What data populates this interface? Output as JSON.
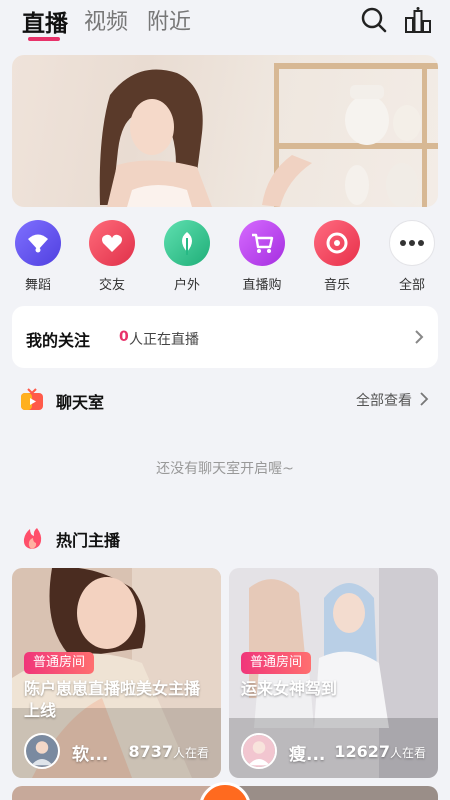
{
  "header": {
    "tabs": [
      {
        "label": "直播",
        "active": true
      },
      {
        "label": "视频",
        "active": false
      },
      {
        "label": "附近",
        "active": false
      }
    ],
    "icons": [
      "search-icon",
      "ranking-icon"
    ],
    "accent": "#e8326a"
  },
  "banner": {
    "image": "photo-banner"
  },
  "categories": [
    {
      "label": "舞蹈",
      "icon": "fan-icon",
      "color": "#6b5cf0"
    },
    {
      "label": "交友",
      "icon": "heart-icon",
      "color": "#f04a60"
    },
    {
      "label": "户外",
      "icon": "leaf-icon",
      "color": "#2fc08a"
    },
    {
      "label": "直播购",
      "icon": "cart-icon",
      "color": "#c045f0"
    },
    {
      "label": "音乐",
      "icon": "music-disc-icon",
      "color": "#f2425a"
    },
    {
      "label": "全部",
      "icon": "more-dots-icon",
      "color": "#ffffff"
    }
  ],
  "follow": {
    "title": "我的关注",
    "count": "0",
    "status": "人正在直播"
  },
  "chatroom": {
    "title": "聊天室",
    "see_all": "全部查看",
    "empty": "还没有聊天室开启喔~"
  },
  "hot": {
    "title": "热门主播",
    "streams": [
      {
        "tag": "普通房间",
        "title": "陈户崽崽直播啦美女主播上线",
        "name": "软...",
        "viewers": "8737",
        "viewers_suffix": "人在看"
      },
      {
        "tag": "普通房间",
        "title": "运来女神驾到",
        "name": "瘦...",
        "viewers": "12627",
        "viewers_suffix": "人在看"
      }
    ]
  }
}
